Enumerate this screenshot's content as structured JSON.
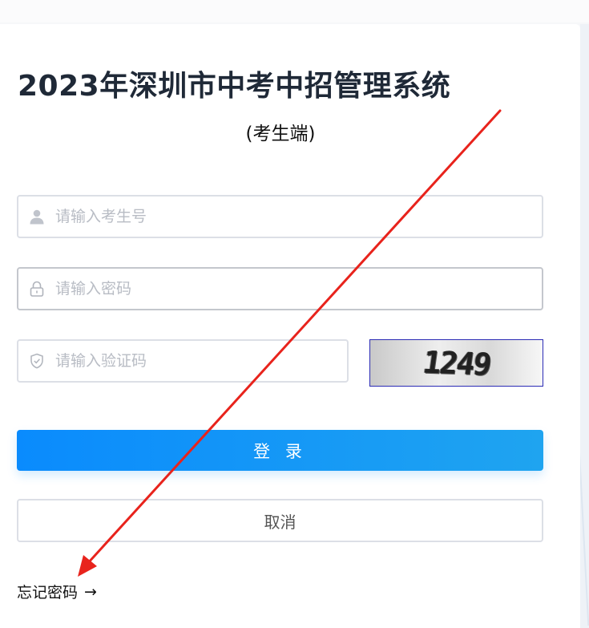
{
  "header": {
    "title": "2023年深圳市中考中招管理系统",
    "subtitle": "(考生端)"
  },
  "form": {
    "username_placeholder": "请输入考生号",
    "password_placeholder": "请输入密码",
    "captcha_placeholder": "请输入验证码",
    "captcha_text": "1249",
    "login_label": "登 录",
    "cancel_label": "取消",
    "forgot_label": "忘记密码",
    "forgot_arrow": "→"
  },
  "icons": {
    "username": "user-icon",
    "password": "lock-icon",
    "captcha": "shield-check-icon",
    "forgot": "arrow-right-icon"
  },
  "colors": {
    "primary": "#0a8bfd",
    "primary_end": "#1fa4f0",
    "title": "#1f2937",
    "placeholder": "#b8bcc4",
    "border": "#dcdfe6",
    "annotation_arrow": "#e8231c"
  }
}
